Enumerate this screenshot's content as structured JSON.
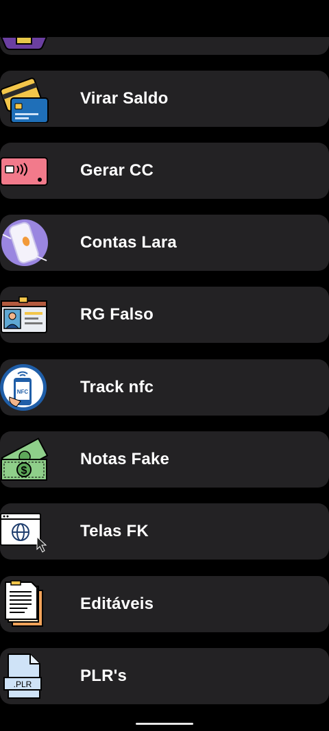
{
  "menu": {
    "items": [
      {
        "label": "",
        "icon": "purple-box-icon"
      },
      {
        "label": "Virar Saldo",
        "icon": "credit-cards-icon"
      },
      {
        "label": "Gerar CC",
        "icon": "contactless-card-icon"
      },
      {
        "label": "Contas Lara",
        "icon": "phone-app-icon"
      },
      {
        "label": "RG Falso",
        "icon": "id-card-icon"
      },
      {
        "label": "Track nfc",
        "icon": "nfc-phone-icon"
      },
      {
        "label": "Notas Fake",
        "icon": "money-bills-icon"
      },
      {
        "label": "Telas FK",
        "icon": "browser-globe-icon"
      },
      {
        "label": "Editáveis",
        "icon": "documents-icon"
      },
      {
        "label": "PLR's",
        "icon": "plr-file-icon"
      }
    ]
  },
  "icon_labels": {
    "nfc": "NFC",
    "plr": ".PLR",
    "dollar": "$"
  },
  "colors": {
    "background": "#000000",
    "card": "#232224",
    "text": "#ffffff"
  }
}
